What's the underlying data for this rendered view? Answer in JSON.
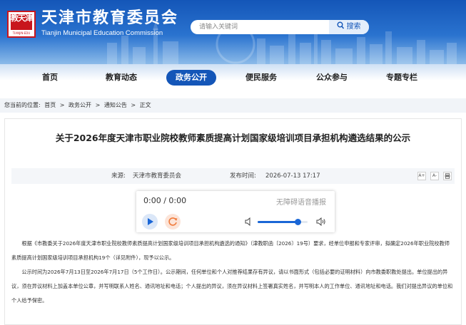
{
  "site": {
    "logo_text": "教天津",
    "logo_sub": "TIANJIN·EDU",
    "title": "天津市教育委员会",
    "subtitle": "Tianjin Municipal Education Commission"
  },
  "search": {
    "placeholder": "请输入关键词",
    "button_label": "搜索"
  },
  "nav": {
    "items": [
      {
        "label": "首页"
      },
      {
        "label": "教育动态"
      },
      {
        "label": "政务公开"
      },
      {
        "label": "便民服务"
      },
      {
        "label": "公众参与"
      },
      {
        "label": "专题专栏"
      }
    ],
    "active_index": 2
  },
  "breadcrumb": {
    "prefix": "您当前的位置:",
    "items": [
      "首页",
      "政务公开",
      "通知公告",
      "正文"
    ],
    "separator": ">"
  },
  "article": {
    "title": "关于2026年度天津市职业院校教师素质提高计划国家级培训项目承担机构遴选结果的公示",
    "source_label": "来源:",
    "source": "天津市教育委员会",
    "date_label": "发布时间:",
    "date": "2026-07-13 17:17",
    "tools": [
      "A+",
      "A-",
      "⎙"
    ],
    "paragraphs": [
      "根据《市教委关于2026年度天津市职业院校教师素质提高计划国家级培训项目承担机构遴选的通知》（津教职函〔2026〕19号）要求，经单位申报和专家评审，拟确定2026年职业院校教师素质提高计划国家级培训项目承担机构19个（详见附件），现予以公示。",
      "公示时间为2026年7月13日至2026年7月17日（5个工作日）。公示期间，任何单位和个人对推荐结果存有异议，请以书面形式（包括必要的证明材料）向市教委职教处提出。单位提出的异议，须在异议材料上加盖本单位公章，并写明联系人姓名、通讯地址和电话；个人提出的异议，须在异议材料上签署真实姓名，并写明本人的工作单位、通讯地址和电话。我们对提出异议的单位和个人给予保密。"
    ]
  },
  "player": {
    "time": "0:00 / 0:00",
    "hint": "无障碍语音播报",
    "volume": 0.8
  },
  "colors": {
    "brand_blue": "#1456b8",
    "accent_blue": "#1a66d6",
    "logo_red": "#c8161d",
    "replay_orange": "#f07a3a"
  },
  "icons": [
    "search-icon",
    "play-icon",
    "replay-icon",
    "volume-low-icon",
    "volume-high-icon",
    "print-icon"
  ]
}
